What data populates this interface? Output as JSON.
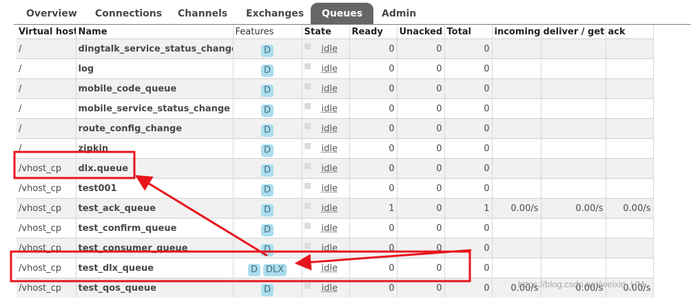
{
  "tabs": [
    {
      "label": "Overview",
      "active": false
    },
    {
      "label": "Connections",
      "active": false
    },
    {
      "label": "Channels",
      "active": false
    },
    {
      "label": "Exchanges",
      "active": false
    },
    {
      "label": "Queues",
      "active": true
    },
    {
      "label": "Admin",
      "active": false
    }
  ],
  "table": {
    "headers": {
      "vhost": "Virtual host",
      "name": "Name",
      "features": "Features",
      "state": "State",
      "ready": "Ready",
      "unacked": "Unacked",
      "total": "Total",
      "incoming": "incoming",
      "deliver": "deliver / get",
      "ack": "ack"
    },
    "rows": [
      {
        "vhost": "/",
        "name": "dingtalk_service_status_change",
        "f1": "D",
        "f2": "",
        "state": "idle",
        "ready": "0",
        "unacked": "0",
        "total": "0",
        "incoming": "",
        "deliver": "",
        "ack": ""
      },
      {
        "vhost": "/",
        "name": "log",
        "f1": "D",
        "f2": "",
        "state": "idle",
        "ready": "0",
        "unacked": "0",
        "total": "0",
        "incoming": "",
        "deliver": "",
        "ack": ""
      },
      {
        "vhost": "/",
        "name": "mobile_code_queue",
        "f1": "D",
        "f2": "",
        "state": "idle",
        "ready": "0",
        "unacked": "0",
        "total": "0",
        "incoming": "",
        "deliver": "",
        "ack": ""
      },
      {
        "vhost": "/",
        "name": "mobile_service_status_change",
        "f1": "D",
        "f2": "",
        "state": "idle",
        "ready": "0",
        "unacked": "0",
        "total": "0",
        "incoming": "",
        "deliver": "",
        "ack": ""
      },
      {
        "vhost": "/",
        "name": "route_config_change",
        "f1": "D",
        "f2": "",
        "state": "idle",
        "ready": "0",
        "unacked": "0",
        "total": "0",
        "incoming": "",
        "deliver": "",
        "ack": ""
      },
      {
        "vhost": "/",
        "name": "zipkin",
        "f1": "D",
        "f2": "",
        "state": "idle",
        "ready": "0",
        "unacked": "0",
        "total": "0",
        "incoming": "",
        "deliver": "",
        "ack": ""
      },
      {
        "vhost": "/vhost_cp",
        "name": "dlx.queue",
        "f1": "D",
        "f2": "",
        "state": "idle",
        "ready": "0",
        "unacked": "0",
        "total": "0",
        "incoming": "",
        "deliver": "",
        "ack": ""
      },
      {
        "vhost": "/vhost_cp",
        "name": "test001",
        "f1": "D",
        "f2": "",
        "state": "idle",
        "ready": "0",
        "unacked": "0",
        "total": "0",
        "incoming": "",
        "deliver": "",
        "ack": ""
      },
      {
        "vhost": "/vhost_cp",
        "name": "test_ack_queue",
        "f1": "D",
        "f2": "",
        "state": "idle",
        "ready": "1",
        "unacked": "0",
        "total": "1",
        "incoming": "0.00/s",
        "deliver": "0.00/s",
        "ack": "0.00/s"
      },
      {
        "vhost": "/vhost_cp",
        "name": "test_confirm_queue",
        "f1": "D",
        "f2": "",
        "state": "idle",
        "ready": "0",
        "unacked": "0",
        "total": "0",
        "incoming": "",
        "deliver": "",
        "ack": ""
      },
      {
        "vhost": "/vhost_cp",
        "name": "test_consumer_queue",
        "f1": "D",
        "f2": "",
        "state": "idle",
        "ready": "0",
        "unacked": "0",
        "total": "0",
        "incoming": "",
        "deliver": "",
        "ack": ""
      },
      {
        "vhost": "/vhost_cp",
        "name": "test_dlx_queue",
        "f1": "D",
        "f2": "DLX",
        "state": "idle",
        "ready": "0",
        "unacked": "0",
        "total": "0",
        "incoming": "",
        "deliver": "",
        "ack": ""
      },
      {
        "vhost": "/vhost_cp",
        "name": "test_qos_queue",
        "f1": "D",
        "f2": "",
        "state": "idle",
        "ready": "0",
        "unacked": "0",
        "total": "0",
        "incoming": "0.00/s",
        "deliver": "0.00/s",
        "ack": "0.00/s"
      }
    ]
  },
  "annotation": {
    "color": "#e8141b"
  },
  "watermark": "https://blog.csdn.net/weixin_HM"
}
